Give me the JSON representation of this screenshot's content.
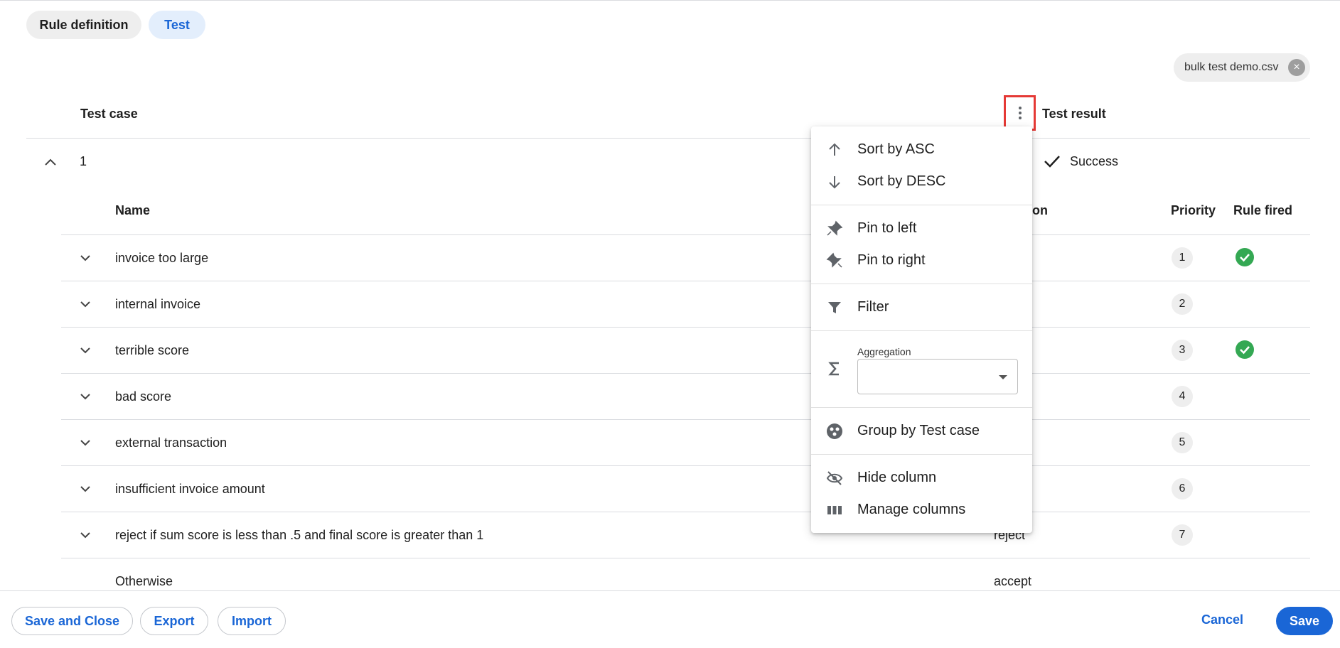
{
  "tabs": {
    "rule_definition": "Rule definition",
    "test": "Test"
  },
  "file_chip": {
    "name": "bulk test demo.csv"
  },
  "header": {
    "test_case": "Test case",
    "test_result": "Test result"
  },
  "test_case": {
    "number": "1",
    "result": "Success"
  },
  "inner_table": {
    "columns": {
      "name": "Name",
      "action": "on",
      "priority": "Priority",
      "rule_fired": "Rule fired"
    },
    "rows": [
      {
        "name": "invoice too large",
        "action": "",
        "priority": "1",
        "fired": true
      },
      {
        "name": "internal invoice",
        "action": "",
        "priority": "2",
        "fired": false
      },
      {
        "name": "terrible score",
        "action": "",
        "priority": "3",
        "fired": true
      },
      {
        "name": "bad score",
        "action": "",
        "priority": "4",
        "fired": false
      },
      {
        "name": "external transaction",
        "action": "",
        "priority": "5",
        "fired": false
      },
      {
        "name": "insufficient invoice amount",
        "action": "",
        "priority": "6",
        "fired": false
      },
      {
        "name": "reject if sum score is less than .5 and final score is greater than 1",
        "action": "reject",
        "priority": "7",
        "fired": false
      },
      {
        "name": "Otherwise",
        "action": "accept",
        "priority": "",
        "fired": false
      }
    ]
  },
  "column_menu": {
    "sort_asc": "Sort by ASC",
    "sort_desc": "Sort by DESC",
    "pin_left": "Pin to left",
    "pin_right": "Pin to right",
    "filter": "Filter",
    "aggregation_label": "Aggregation",
    "group_by": "Group by Test case",
    "hide_column": "Hide column",
    "manage_columns": "Manage columns"
  },
  "footer": {
    "save_and_close": "Save and Close",
    "export": "Export",
    "import": "Import",
    "cancel": "Cancel",
    "save": "Save"
  },
  "colors": {
    "accent": "#1a66d6",
    "success": "#34a853",
    "highlight_box": "#e53935"
  }
}
